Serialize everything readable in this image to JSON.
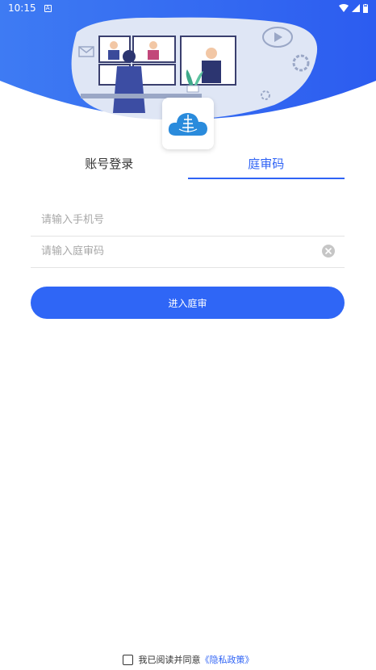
{
  "status_bar": {
    "time": "10:15",
    "notification_glyph": "A"
  },
  "tabs": [
    {
      "label": "账号登录",
      "active": false
    },
    {
      "label": "庭审码",
      "active": true
    }
  ],
  "form": {
    "phone_placeholder": "请输入手机号",
    "phone_value": "",
    "code_placeholder": "请输入庭审码",
    "code_value": "",
    "submit_label": "进入庭审"
  },
  "agreement": {
    "text": "我已阅读并同意",
    "link_label": "《隐私政策》",
    "checked": false
  },
  "colors": {
    "accent": "#2f63f5",
    "header_gradient_start": "#3e7bf3",
    "header_gradient_end": "#2c5cf0"
  },
  "icons": [
    "wifi-icon",
    "signal-icon",
    "battery-icon",
    "court-logo-icon",
    "clear-icon"
  ]
}
